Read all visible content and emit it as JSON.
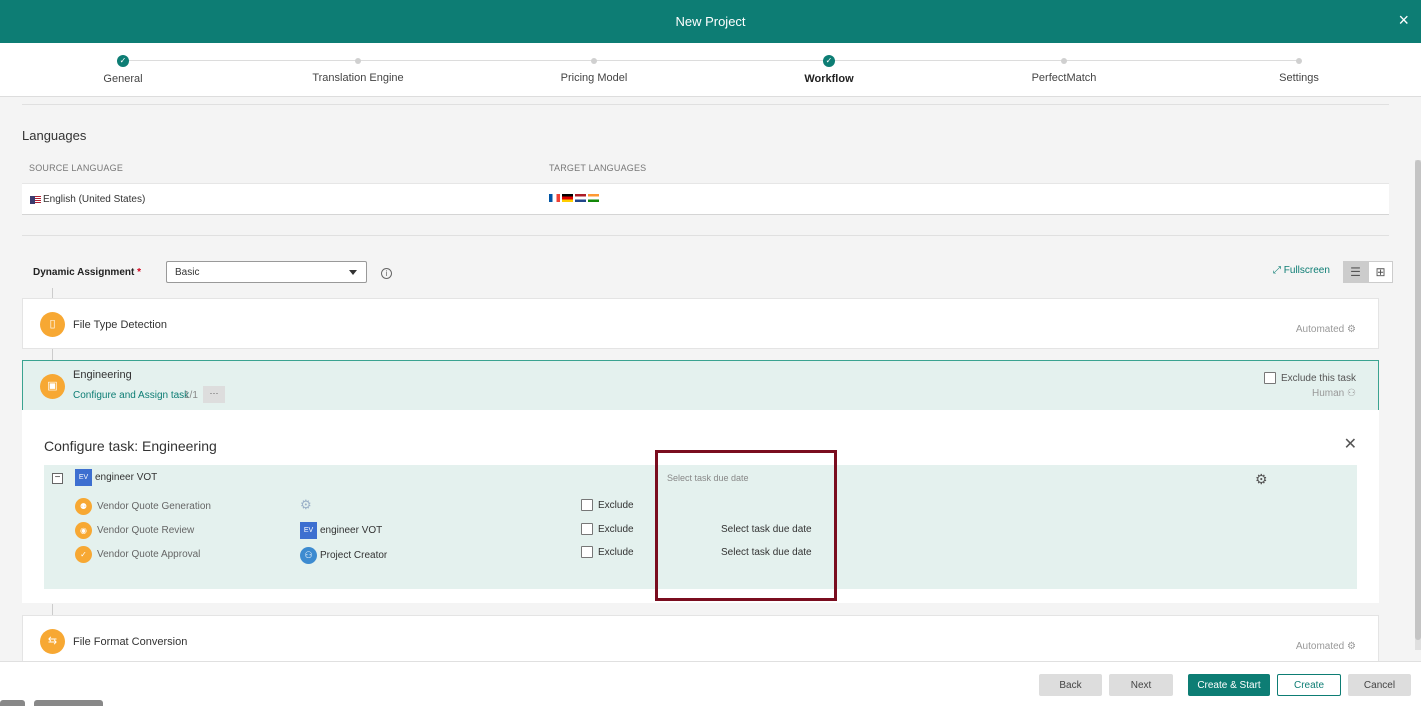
{
  "header": {
    "title": "New Project",
    "close_icon": "×"
  },
  "steps": [
    {
      "label": "General",
      "state": "done"
    },
    {
      "label": "Translation Engine",
      "state": "pending"
    },
    {
      "label": "Pricing Model",
      "state": "pending"
    },
    {
      "label": "Workflow",
      "state": "current"
    },
    {
      "label": "PerfectMatch",
      "state": "pending"
    },
    {
      "label": "Settings",
      "state": "pending"
    }
  ],
  "languages": {
    "title": "Languages",
    "source_header": "SOURCE LANGUAGE",
    "target_header": "TARGET LANGUAGES",
    "source": "English (United States)",
    "targets": [
      "fr",
      "de",
      "nl",
      "in"
    ]
  },
  "assignment": {
    "label": "Dynamic Assignment",
    "required_mark": "*",
    "value": "Basic",
    "fullscreen": "Fullscreen"
  },
  "tasks": {
    "file_type": {
      "name": "File Type Detection",
      "mode": "Automated"
    },
    "engineering": {
      "name": "Engineering",
      "configure": "Configure and Assign task",
      "count": "1/1",
      "more": "···",
      "exclude": "Exclude this task",
      "mode": "Human"
    },
    "file_format": {
      "name": "File Format Conversion",
      "mode": "Automated"
    }
  },
  "configure": {
    "title": "Configure task: Engineering",
    "group": {
      "badge": "EV",
      "name": "engineer VOT",
      "due": "Select task due date"
    },
    "subtasks": [
      {
        "name": "Vendor Quote Generation",
        "assignee": "",
        "exclude": "Exclude",
        "due": ""
      },
      {
        "name": "Vendor Quote Review",
        "assignee": "engineer VOT",
        "badge": "EV",
        "exclude": "Exclude",
        "due": "Select task due date"
      },
      {
        "name": "Vendor Quote Approval",
        "assignee": "Project Creator",
        "exclude": "Exclude",
        "due": "Select task due date"
      }
    ]
  },
  "footer": {
    "back": "Back",
    "next": "Next",
    "create_start": "Create & Start",
    "create": "Create",
    "cancel": "Cancel"
  },
  "colors": {
    "brand": "#0d7d74",
    "task_icon": "#f7a833",
    "highlight": "#7a0d1f"
  }
}
